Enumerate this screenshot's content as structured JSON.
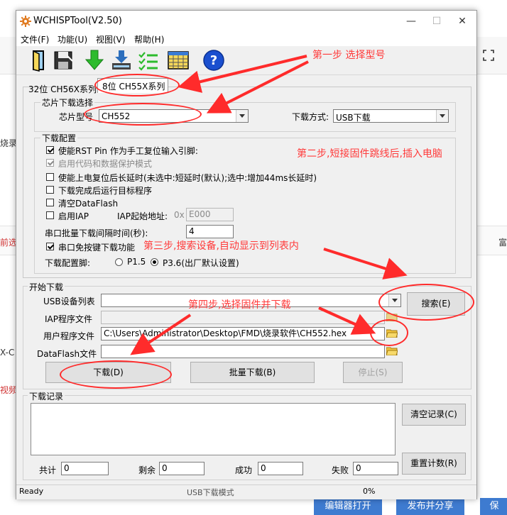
{
  "window": {
    "title": "WCHISPTool(V2.50)"
  },
  "menu": [
    "文件(F)",
    "功能(U)",
    "视图(V)",
    "帮助(H)"
  ],
  "tabs": {
    "tab_32": "32位 CH56X系列",
    "tab_8": "8位 CH55X系列"
  },
  "chip_select": {
    "legend": "芯片下载选择",
    "model_label": "芯片型号",
    "model_value": "CH552",
    "mode_label": "下载方式:",
    "mode_value": "USB下载"
  },
  "config": {
    "legend": "下载配置",
    "rst_pin": "使能RST Pin 作为手工复位输入引脚:",
    "protect": "启用代码和数据保护模式",
    "delay": "使能上电复位后长延时(未选中:短延时(默认);选中:增加44ms长延时)",
    "run_after": "下载完成后运行目标程序",
    "clear_flash": "清空DataFlash",
    "enable_iap": "启用IAP",
    "iap_addr_label": "IAP起始地址:",
    "iap_prefix": "0x",
    "iap_addr_value": "E000",
    "interval_label": "串口批量下载间隔时间(秒):",
    "interval_value": "4",
    "serial_nokey": "串口免按键下载功能",
    "pin_label": "下载配置脚:",
    "pin_opt1": "P1.5",
    "pin_opt2": "P3.6(出厂默认设置)"
  },
  "download": {
    "legend": "开始下载",
    "usb_list_label": "USB设备列表",
    "usb_list_value": "",
    "search_btn": "搜索(E)",
    "iap_file_label": "IAP程序文件",
    "iap_file_value": "",
    "user_file_label": "用户程序文件",
    "user_file_value": "C:\\Users\\Administrator\\Desktop\\FMD\\烧录软件\\CH552.hex",
    "dataflash_label": "DataFlash文件",
    "dataflash_value": "",
    "download_btn": "下载(D)",
    "batch_btn": "批量下载(B)",
    "stop_btn": "停止(S)"
  },
  "log": {
    "legend": "下载记录",
    "clear_btn": "清空记录(C)",
    "reset_btn": "重置计数(R)",
    "total_label": "共计",
    "total_value": "0",
    "remain_label": "剩余",
    "remain_value": "0",
    "success_label": "成功",
    "success_value": "0",
    "fail_label": "失败",
    "fail_value": "0"
  },
  "status": {
    "state": "Ready",
    "mode": "USB下载模式",
    "progress": "0%"
  },
  "annotations": {
    "step1": "第一步 选择型号",
    "step2": "第二步,短接固件跳线后,插入电脑",
    "step3": "第三步,搜索设备,自动显示到列表内",
    "step4": "第四步,选择固件并下载"
  },
  "background": {
    "frag1": "烧录",
    "frag2": "前选",
    "frag3": "X-C",
    "frag4": "视频",
    "frag5": "富",
    "btn_editor": "编辑器打开",
    "btn_publish": "发布并分享",
    "btn_save": "保"
  },
  "colors": {
    "annotation": "#ff2b2b",
    "accent": "#3e7bd0"
  }
}
